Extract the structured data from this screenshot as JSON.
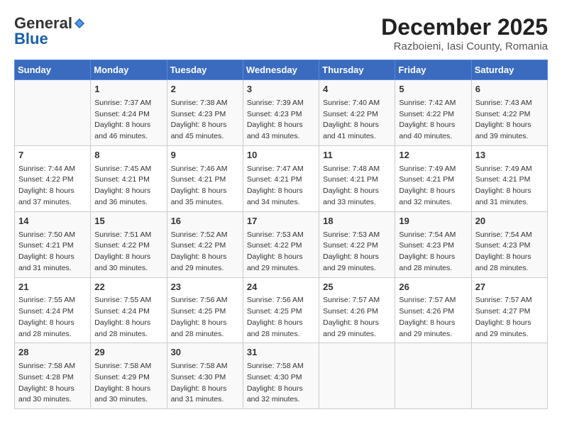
{
  "header": {
    "logo_general": "General",
    "logo_blue": "Blue",
    "month_title": "December 2025",
    "location": "Razboieni, Iasi County, Romania"
  },
  "days_of_week": [
    "Sunday",
    "Monday",
    "Tuesday",
    "Wednesday",
    "Thursday",
    "Friday",
    "Saturday"
  ],
  "weeks": [
    [
      {
        "day": "",
        "data": ""
      },
      {
        "day": "1",
        "data": "Sunrise: 7:37 AM\nSunset: 4:24 PM\nDaylight: 8 hours\nand 46 minutes."
      },
      {
        "day": "2",
        "data": "Sunrise: 7:38 AM\nSunset: 4:23 PM\nDaylight: 8 hours\nand 45 minutes."
      },
      {
        "day": "3",
        "data": "Sunrise: 7:39 AM\nSunset: 4:23 PM\nDaylight: 8 hours\nand 43 minutes."
      },
      {
        "day": "4",
        "data": "Sunrise: 7:40 AM\nSunset: 4:22 PM\nDaylight: 8 hours\nand 41 minutes."
      },
      {
        "day": "5",
        "data": "Sunrise: 7:42 AM\nSunset: 4:22 PM\nDaylight: 8 hours\nand 40 minutes."
      },
      {
        "day": "6",
        "data": "Sunrise: 7:43 AM\nSunset: 4:22 PM\nDaylight: 8 hours\nand 39 minutes."
      }
    ],
    [
      {
        "day": "7",
        "data": "Sunrise: 7:44 AM\nSunset: 4:22 PM\nDaylight: 8 hours\nand 37 minutes."
      },
      {
        "day": "8",
        "data": "Sunrise: 7:45 AM\nSunset: 4:21 PM\nDaylight: 8 hours\nand 36 minutes."
      },
      {
        "day": "9",
        "data": "Sunrise: 7:46 AM\nSunset: 4:21 PM\nDaylight: 8 hours\nand 35 minutes."
      },
      {
        "day": "10",
        "data": "Sunrise: 7:47 AM\nSunset: 4:21 PM\nDaylight: 8 hours\nand 34 minutes."
      },
      {
        "day": "11",
        "data": "Sunrise: 7:48 AM\nSunset: 4:21 PM\nDaylight: 8 hours\nand 33 minutes."
      },
      {
        "day": "12",
        "data": "Sunrise: 7:49 AM\nSunset: 4:21 PM\nDaylight: 8 hours\nand 32 minutes."
      },
      {
        "day": "13",
        "data": "Sunrise: 7:49 AM\nSunset: 4:21 PM\nDaylight: 8 hours\nand 31 minutes."
      }
    ],
    [
      {
        "day": "14",
        "data": "Sunrise: 7:50 AM\nSunset: 4:21 PM\nDaylight: 8 hours\nand 31 minutes."
      },
      {
        "day": "15",
        "data": "Sunrise: 7:51 AM\nSunset: 4:22 PM\nDaylight: 8 hours\nand 30 minutes."
      },
      {
        "day": "16",
        "data": "Sunrise: 7:52 AM\nSunset: 4:22 PM\nDaylight: 8 hours\nand 29 minutes."
      },
      {
        "day": "17",
        "data": "Sunrise: 7:53 AM\nSunset: 4:22 PM\nDaylight: 8 hours\nand 29 minutes."
      },
      {
        "day": "18",
        "data": "Sunrise: 7:53 AM\nSunset: 4:22 PM\nDaylight: 8 hours\nand 29 minutes."
      },
      {
        "day": "19",
        "data": "Sunrise: 7:54 AM\nSunset: 4:23 PM\nDaylight: 8 hours\nand 28 minutes."
      },
      {
        "day": "20",
        "data": "Sunrise: 7:54 AM\nSunset: 4:23 PM\nDaylight: 8 hours\nand 28 minutes."
      }
    ],
    [
      {
        "day": "21",
        "data": "Sunrise: 7:55 AM\nSunset: 4:24 PM\nDaylight: 8 hours\nand 28 minutes."
      },
      {
        "day": "22",
        "data": "Sunrise: 7:55 AM\nSunset: 4:24 PM\nDaylight: 8 hours\nand 28 minutes."
      },
      {
        "day": "23",
        "data": "Sunrise: 7:56 AM\nSunset: 4:25 PM\nDaylight: 8 hours\nand 28 minutes."
      },
      {
        "day": "24",
        "data": "Sunrise: 7:56 AM\nSunset: 4:25 PM\nDaylight: 8 hours\nand 28 minutes."
      },
      {
        "day": "25",
        "data": "Sunrise: 7:57 AM\nSunset: 4:26 PM\nDaylight: 8 hours\nand 29 minutes."
      },
      {
        "day": "26",
        "data": "Sunrise: 7:57 AM\nSunset: 4:26 PM\nDaylight: 8 hours\nand 29 minutes."
      },
      {
        "day": "27",
        "data": "Sunrise: 7:57 AM\nSunset: 4:27 PM\nDaylight: 8 hours\nand 29 minutes."
      }
    ],
    [
      {
        "day": "28",
        "data": "Sunrise: 7:58 AM\nSunset: 4:28 PM\nDaylight: 8 hours\nand 30 minutes."
      },
      {
        "day": "29",
        "data": "Sunrise: 7:58 AM\nSunset: 4:29 PM\nDaylight: 8 hours\nand 30 minutes."
      },
      {
        "day": "30",
        "data": "Sunrise: 7:58 AM\nSunset: 4:30 PM\nDaylight: 8 hours\nand 31 minutes."
      },
      {
        "day": "31",
        "data": "Sunrise: 7:58 AM\nSunset: 4:30 PM\nDaylight: 8 hours\nand 32 minutes."
      },
      {
        "day": "",
        "data": ""
      },
      {
        "day": "",
        "data": ""
      },
      {
        "day": "",
        "data": ""
      }
    ]
  ]
}
